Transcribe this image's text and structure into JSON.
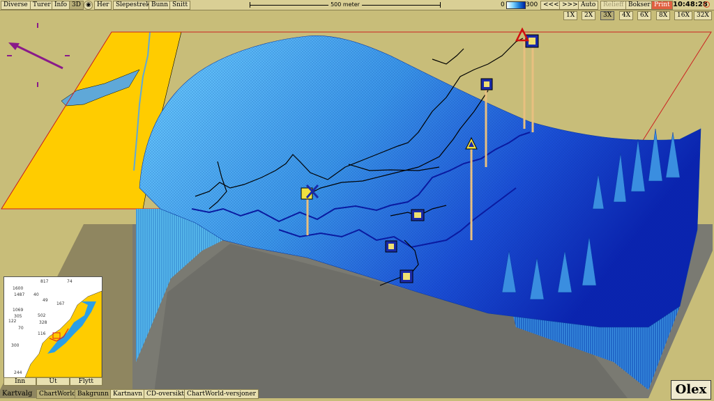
{
  "menu": {
    "items": [
      "Diverse",
      "Turer",
      "Info",
      "3D",
      "Her",
      "Slepestrek",
      "Bunn",
      "Snitt"
    ]
  },
  "scale": {
    "label": "500 meter"
  },
  "depth_legend": {
    "min": "0",
    "max": "300",
    "gradient_colors": [
      "#ffffff",
      "#7fd4ff",
      "#1a7dd8",
      "#0020a0"
    ]
  },
  "nav_buttons": [
    "<<<",
    ">>>",
    "Auto",
    "Relieff",
    "Bokser",
    "Print"
  ],
  "clock": "10:48:28",
  "zoom": {
    "options": [
      "1X",
      "2X",
      "3X",
      "4X",
      "6X",
      "8X",
      "16X",
      "32X"
    ],
    "selected": "3X"
  },
  "minimap": {
    "labels": [
      "817",
      "74",
      "1600",
      "1487",
      "40",
      "49",
      "167",
      "1069",
      "305",
      "502",
      "328",
      "122",
      "70",
      "116",
      "300",
      "244"
    ],
    "buttons": [
      "Inn",
      "Ut",
      "Flytt"
    ]
  },
  "bottom": {
    "label": "Kartvalg",
    "buttons": [
      "ChartWorld",
      "Bakgrunn",
      "Kartnavn",
      "CD-oversikt",
      "ChartWorld-versjoner"
    ]
  },
  "brand": "Olex",
  "colors": {
    "land": "#ffcc00",
    "sea_light": "#5fc6ff",
    "sea_deep": "#1030c8",
    "background": "#c8bd79",
    "frame": "#cc2020"
  }
}
